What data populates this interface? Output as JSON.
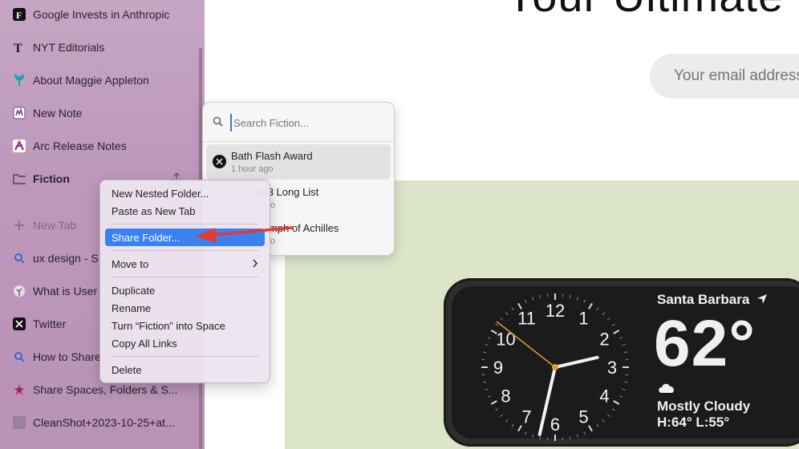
{
  "sidebar": {
    "items": [
      {
        "label": "Google Invests in Anthropic",
        "icon": "f-logo-icon"
      },
      {
        "label": "NYT Editorials",
        "icon": "nyt-logo-icon"
      },
      {
        "label": "About Maggie Appleton",
        "icon": "plant-logo-icon"
      },
      {
        "label": "New Note",
        "icon": "note-icon"
      },
      {
        "label": "Arc Release Notes",
        "icon": "arc-logo-icon"
      },
      {
        "label": "Fiction",
        "icon": "folder-icon"
      },
      {
        "label": "New Tab",
        "icon": "plus-icon"
      },
      {
        "label": "ux design - S",
        "icon": "search-icon"
      },
      {
        "label": "What is User",
        "icon": "tree-icon"
      },
      {
        "label": "Twitter",
        "icon": "x-logo-icon"
      },
      {
        "label": "How to Share",
        "icon": "search-icon"
      },
      {
        "label": "Share Spaces, Folders & S...",
        "icon": "star-logo-icon"
      },
      {
        "label": "CleanShot+2023-10-25+at...",
        "icon": "image-icon"
      }
    ]
  },
  "page": {
    "title_fragment": "Your Ultimate",
    "email_placeholder": "Your email address"
  },
  "popover": {
    "search_placeholder": "Search Fiction...",
    "items": [
      {
        "title": "Bath Flash Award",
        "subtitle": "1 hour ago"
      },
      {
        "title": "2023 Long List",
        "subtitle": "o"
      },
      {
        "title": "mph of Achilles",
        "subtitle": "o"
      }
    ]
  },
  "context_menu": {
    "new_nested_folder": "New Nested Folder...",
    "paste_as_new_tab": "Paste as New Tab",
    "share_folder": "Share Folder...",
    "move_to": "Move to",
    "duplicate": "Duplicate",
    "rename": "Rename",
    "turn_into_space": "Turn “Fiction” into Space",
    "copy_all_links": "Copy All Links",
    "delete": "Delete"
  },
  "standby": {
    "city": "Santa Barbara",
    "temperature": "62°",
    "condition": "Mostly Cloudy",
    "high_low": "H:64° L:55°",
    "clock_numbers": [
      "12",
      "1",
      "2",
      "3",
      "4",
      "5",
      "6",
      "7",
      "8",
      "9",
      "10",
      "11"
    ]
  },
  "colors": {
    "sidebar": "#bd98bb",
    "menu_highlight": "#3a82f0",
    "arrow": "#e53935",
    "green_panel": "#dce5c8"
  }
}
